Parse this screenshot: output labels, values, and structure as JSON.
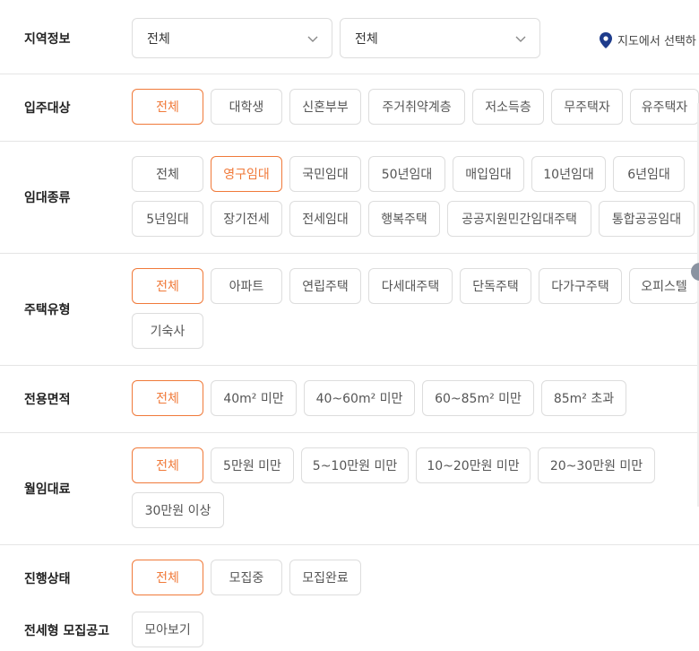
{
  "region": {
    "label": "지역정보",
    "select1": "전체",
    "select2": "전체",
    "map_link": "지도에서 선택하"
  },
  "residents": {
    "label": "입주대상",
    "options": [
      "전체",
      "대학생",
      "신혼부부",
      "주거취약계층",
      "저소득층",
      "무주택자",
      "유주택자"
    ],
    "selected": "전체"
  },
  "rental_type": {
    "label": "임대종류",
    "options": [
      "전체",
      "영구임대",
      "국민임대",
      "50년임대",
      "매입임대",
      "10년임대",
      "6년임대",
      "5년임대",
      "장기전세",
      "전세임대",
      "행복주택",
      "공공지원민간임대주택",
      "통합공공임대"
    ],
    "selected": "영구임대"
  },
  "housing_type": {
    "label": "주택유형",
    "options": [
      "전체",
      "아파트",
      "연립주택",
      "다세대주택",
      "단독주택",
      "다가구주택",
      "오피스텔",
      "기숙사"
    ],
    "selected": "전체"
  },
  "area": {
    "label": "전용면적",
    "options": [
      "전체",
      "40m² 미만",
      "40~60m² 미만",
      "60~85m² 미만",
      "85m² 초과"
    ],
    "selected": "전체"
  },
  "rent": {
    "label": "월임대료",
    "options": [
      "전체",
      "5만원 미만",
      "5~10만원 미만",
      "10~20만원 미만",
      "20~30만원 미만",
      "30만원 이상"
    ],
    "selected": "전체"
  },
  "status": {
    "label": "진행상태",
    "options": [
      "전체",
      "모집중",
      "모집완료"
    ],
    "selected": "전체"
  },
  "jeonse_notice": {
    "label": "전세형 모집공고",
    "button": "모아보기"
  },
  "colors": {
    "accent": "#f07a3a",
    "border": "#dddddd",
    "map_pin": "#1e3c8c"
  },
  "icons": {
    "select_chevron": "chevron-down-icon",
    "map_pin": "map-pin-icon"
  }
}
